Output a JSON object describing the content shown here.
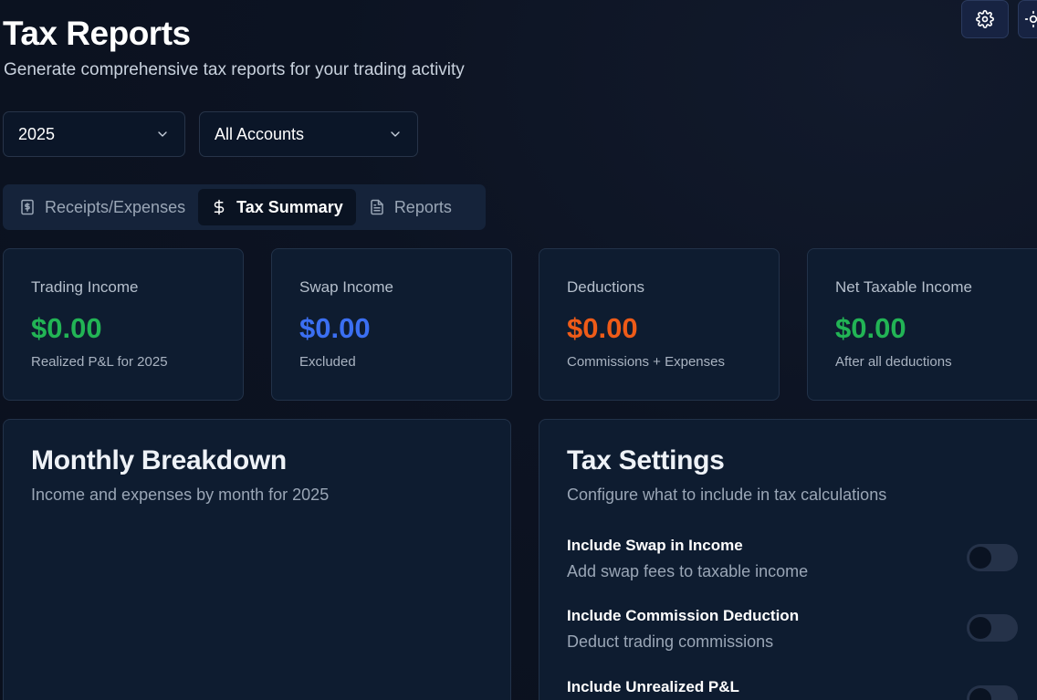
{
  "header": {
    "title": "Tax Reports",
    "subtitle": "Generate comprehensive tax reports for your trading activity",
    "settings_icon": "gear-icon",
    "extra_icon": "sun-icon"
  },
  "filters": {
    "year": "2025",
    "account": "All Accounts"
  },
  "tabs": [
    {
      "label": "Receipts/Expenses",
      "icon": "receipt-icon",
      "active": false
    },
    {
      "label": "Tax Summary",
      "icon": "dollar-icon",
      "active": true
    },
    {
      "label": "Reports",
      "icon": "document-icon",
      "active": false
    }
  ],
  "stats": [
    {
      "label": "Trading Income",
      "value": "$0.00",
      "sub": "Realized P&L for 2025",
      "color": "#22b455"
    },
    {
      "label": "Swap Income",
      "value": "$0.00",
      "sub": "Excluded",
      "color": "#3b6ff2"
    },
    {
      "label": "Deductions",
      "value": "$0.00",
      "sub": "Commissions + Expenses",
      "color": "#ee5b18"
    },
    {
      "label": "Net Taxable Income",
      "value": "$0.00",
      "sub": "After all deductions",
      "color": "#22b455"
    }
  ],
  "monthly": {
    "title": "Monthly Breakdown",
    "subtitle": "Income and expenses by month for 2025"
  },
  "settings": {
    "title": "Tax Settings",
    "subtitle": "Configure what to include in tax calculations",
    "items": [
      {
        "label": "Include Swap in Income",
        "desc": "Add swap fees to taxable income",
        "enabled": false
      },
      {
        "label": "Include Commission Deduction",
        "desc": "Deduct trading commissions",
        "enabled": false
      },
      {
        "label": "Include Unrealized P&L",
        "desc": "",
        "enabled": false
      }
    ]
  }
}
